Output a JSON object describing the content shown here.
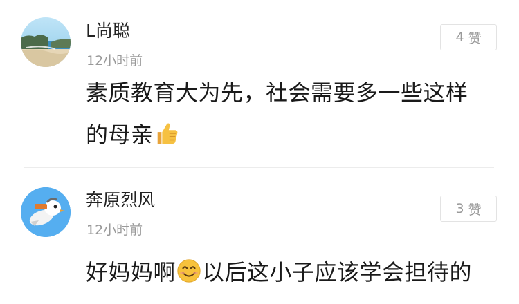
{
  "comments": [
    {
      "username": "L尚聪",
      "time": "12小时前",
      "likes": {
        "count": "4",
        "label": "赞"
      },
      "text_line1": "素质教育大为先，社会需要多一些这样",
      "text_line2": "的母亲",
      "emoji": "thumbs-up-icon",
      "avatar": "beach-landscape-avatar"
    },
    {
      "username": "奔原烈风",
      "time": "12小时前",
      "likes": {
        "count": "3",
        "label": "赞"
      },
      "text_before": "好妈妈啊",
      "text_after": "以后这小子应该学会担待的",
      "emoji": "smiling-face-icon",
      "avatar": "cartoon-bird-avatar"
    }
  ]
}
